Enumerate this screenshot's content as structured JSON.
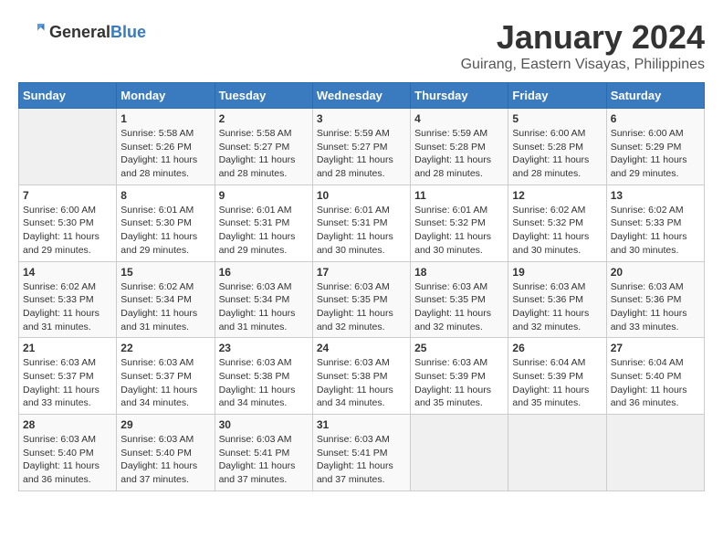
{
  "header": {
    "logo_general": "General",
    "logo_blue": "Blue",
    "title": "January 2024",
    "subtitle": "Guirang, Eastern Visayas, Philippines"
  },
  "calendar": {
    "days_of_week": [
      "Sunday",
      "Monday",
      "Tuesday",
      "Wednesday",
      "Thursday",
      "Friday",
      "Saturday"
    ],
    "weeks": [
      [
        {
          "day": "",
          "info": ""
        },
        {
          "day": "1",
          "info": "Sunrise: 5:58 AM\nSunset: 5:26 PM\nDaylight: 11 hours\nand 28 minutes."
        },
        {
          "day": "2",
          "info": "Sunrise: 5:58 AM\nSunset: 5:27 PM\nDaylight: 11 hours\nand 28 minutes."
        },
        {
          "day": "3",
          "info": "Sunrise: 5:59 AM\nSunset: 5:27 PM\nDaylight: 11 hours\nand 28 minutes."
        },
        {
          "day": "4",
          "info": "Sunrise: 5:59 AM\nSunset: 5:28 PM\nDaylight: 11 hours\nand 28 minutes."
        },
        {
          "day": "5",
          "info": "Sunrise: 6:00 AM\nSunset: 5:28 PM\nDaylight: 11 hours\nand 28 minutes."
        },
        {
          "day": "6",
          "info": "Sunrise: 6:00 AM\nSunset: 5:29 PM\nDaylight: 11 hours\nand 29 minutes."
        }
      ],
      [
        {
          "day": "7",
          "info": "Sunrise: 6:00 AM\nSunset: 5:30 PM\nDaylight: 11 hours\nand 29 minutes."
        },
        {
          "day": "8",
          "info": "Sunrise: 6:01 AM\nSunset: 5:30 PM\nDaylight: 11 hours\nand 29 minutes."
        },
        {
          "day": "9",
          "info": "Sunrise: 6:01 AM\nSunset: 5:31 PM\nDaylight: 11 hours\nand 29 minutes."
        },
        {
          "day": "10",
          "info": "Sunrise: 6:01 AM\nSunset: 5:31 PM\nDaylight: 11 hours\nand 30 minutes."
        },
        {
          "day": "11",
          "info": "Sunrise: 6:01 AM\nSunset: 5:32 PM\nDaylight: 11 hours\nand 30 minutes."
        },
        {
          "day": "12",
          "info": "Sunrise: 6:02 AM\nSunset: 5:32 PM\nDaylight: 11 hours\nand 30 minutes."
        },
        {
          "day": "13",
          "info": "Sunrise: 6:02 AM\nSunset: 5:33 PM\nDaylight: 11 hours\nand 30 minutes."
        }
      ],
      [
        {
          "day": "14",
          "info": "Sunrise: 6:02 AM\nSunset: 5:33 PM\nDaylight: 11 hours\nand 31 minutes."
        },
        {
          "day": "15",
          "info": "Sunrise: 6:02 AM\nSunset: 5:34 PM\nDaylight: 11 hours\nand 31 minutes."
        },
        {
          "day": "16",
          "info": "Sunrise: 6:03 AM\nSunset: 5:34 PM\nDaylight: 11 hours\nand 31 minutes."
        },
        {
          "day": "17",
          "info": "Sunrise: 6:03 AM\nSunset: 5:35 PM\nDaylight: 11 hours\nand 32 minutes."
        },
        {
          "day": "18",
          "info": "Sunrise: 6:03 AM\nSunset: 5:35 PM\nDaylight: 11 hours\nand 32 minutes."
        },
        {
          "day": "19",
          "info": "Sunrise: 6:03 AM\nSunset: 5:36 PM\nDaylight: 11 hours\nand 32 minutes."
        },
        {
          "day": "20",
          "info": "Sunrise: 6:03 AM\nSunset: 5:36 PM\nDaylight: 11 hours\nand 33 minutes."
        }
      ],
      [
        {
          "day": "21",
          "info": "Sunrise: 6:03 AM\nSunset: 5:37 PM\nDaylight: 11 hours\nand 33 minutes."
        },
        {
          "day": "22",
          "info": "Sunrise: 6:03 AM\nSunset: 5:37 PM\nDaylight: 11 hours\nand 34 minutes."
        },
        {
          "day": "23",
          "info": "Sunrise: 6:03 AM\nSunset: 5:38 PM\nDaylight: 11 hours\nand 34 minutes."
        },
        {
          "day": "24",
          "info": "Sunrise: 6:03 AM\nSunset: 5:38 PM\nDaylight: 11 hours\nand 34 minutes."
        },
        {
          "day": "25",
          "info": "Sunrise: 6:03 AM\nSunset: 5:39 PM\nDaylight: 11 hours\nand 35 minutes."
        },
        {
          "day": "26",
          "info": "Sunrise: 6:04 AM\nSunset: 5:39 PM\nDaylight: 11 hours\nand 35 minutes."
        },
        {
          "day": "27",
          "info": "Sunrise: 6:04 AM\nSunset: 5:40 PM\nDaylight: 11 hours\nand 36 minutes."
        }
      ],
      [
        {
          "day": "28",
          "info": "Sunrise: 6:03 AM\nSunset: 5:40 PM\nDaylight: 11 hours\nand 36 minutes."
        },
        {
          "day": "29",
          "info": "Sunrise: 6:03 AM\nSunset: 5:40 PM\nDaylight: 11 hours\nand 37 minutes."
        },
        {
          "day": "30",
          "info": "Sunrise: 6:03 AM\nSunset: 5:41 PM\nDaylight: 11 hours\nand 37 minutes."
        },
        {
          "day": "31",
          "info": "Sunrise: 6:03 AM\nSunset: 5:41 PM\nDaylight: 11 hours\nand 37 minutes."
        },
        {
          "day": "",
          "info": ""
        },
        {
          "day": "",
          "info": ""
        },
        {
          "day": "",
          "info": ""
        }
      ]
    ]
  }
}
